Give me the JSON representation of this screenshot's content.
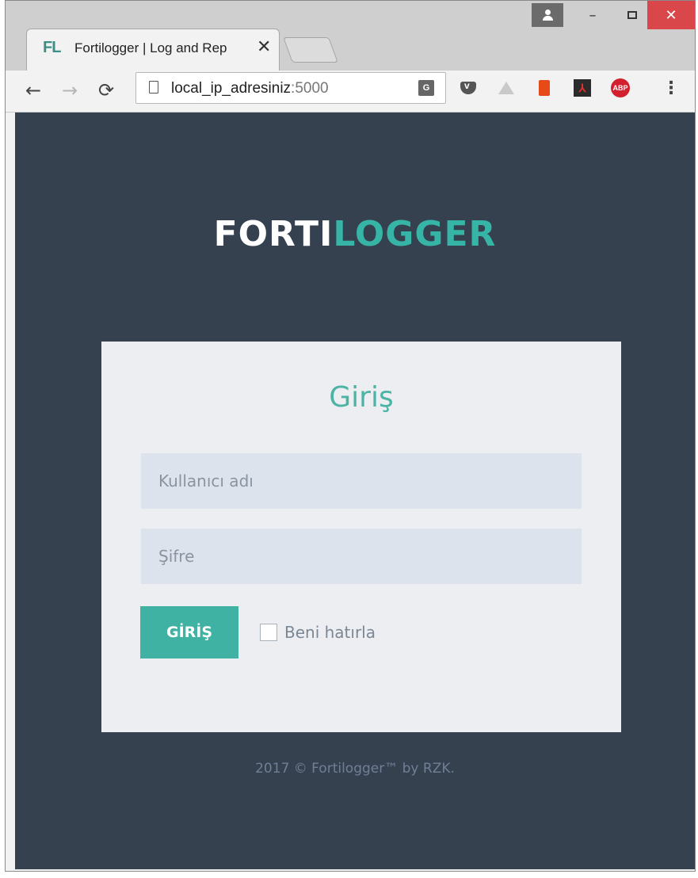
{
  "browser": {
    "tab_favicon": "FL",
    "tab_title": "Fortilogger | Log and Rep",
    "tab_close": "✕",
    "url_host": "local_ip_adresiniz",
    "url_port": ":5000",
    "icons": [
      "back-icon",
      "forward-icon",
      "reload-icon",
      "page-icon",
      "translate-icon",
      "pocket-icon",
      "drive-icon",
      "office-icon",
      "acrobat-icon",
      "adblock-icon",
      "menu-icon"
    ],
    "win_minimize": "–",
    "win_close": "✕",
    "abp_label": "ABP",
    "menu_glyph": "⋮"
  },
  "page": {
    "logo_part1": "FORTI",
    "logo_part2": "LOGGER",
    "logo_colors": {
      "part1": "#ffffff",
      "part2": "#36b5a7"
    },
    "background": "#364150",
    "login": {
      "title": "Giriş",
      "username_placeholder": "Kullanıcı adı",
      "password_placeholder": "Şifre",
      "submit_label": "GİRİŞ",
      "remember_label": "Beni hatırla",
      "remember_checked": false,
      "accent": "#3fb2a3"
    },
    "footer": "2017 © Fortilogger™ by RZK."
  }
}
